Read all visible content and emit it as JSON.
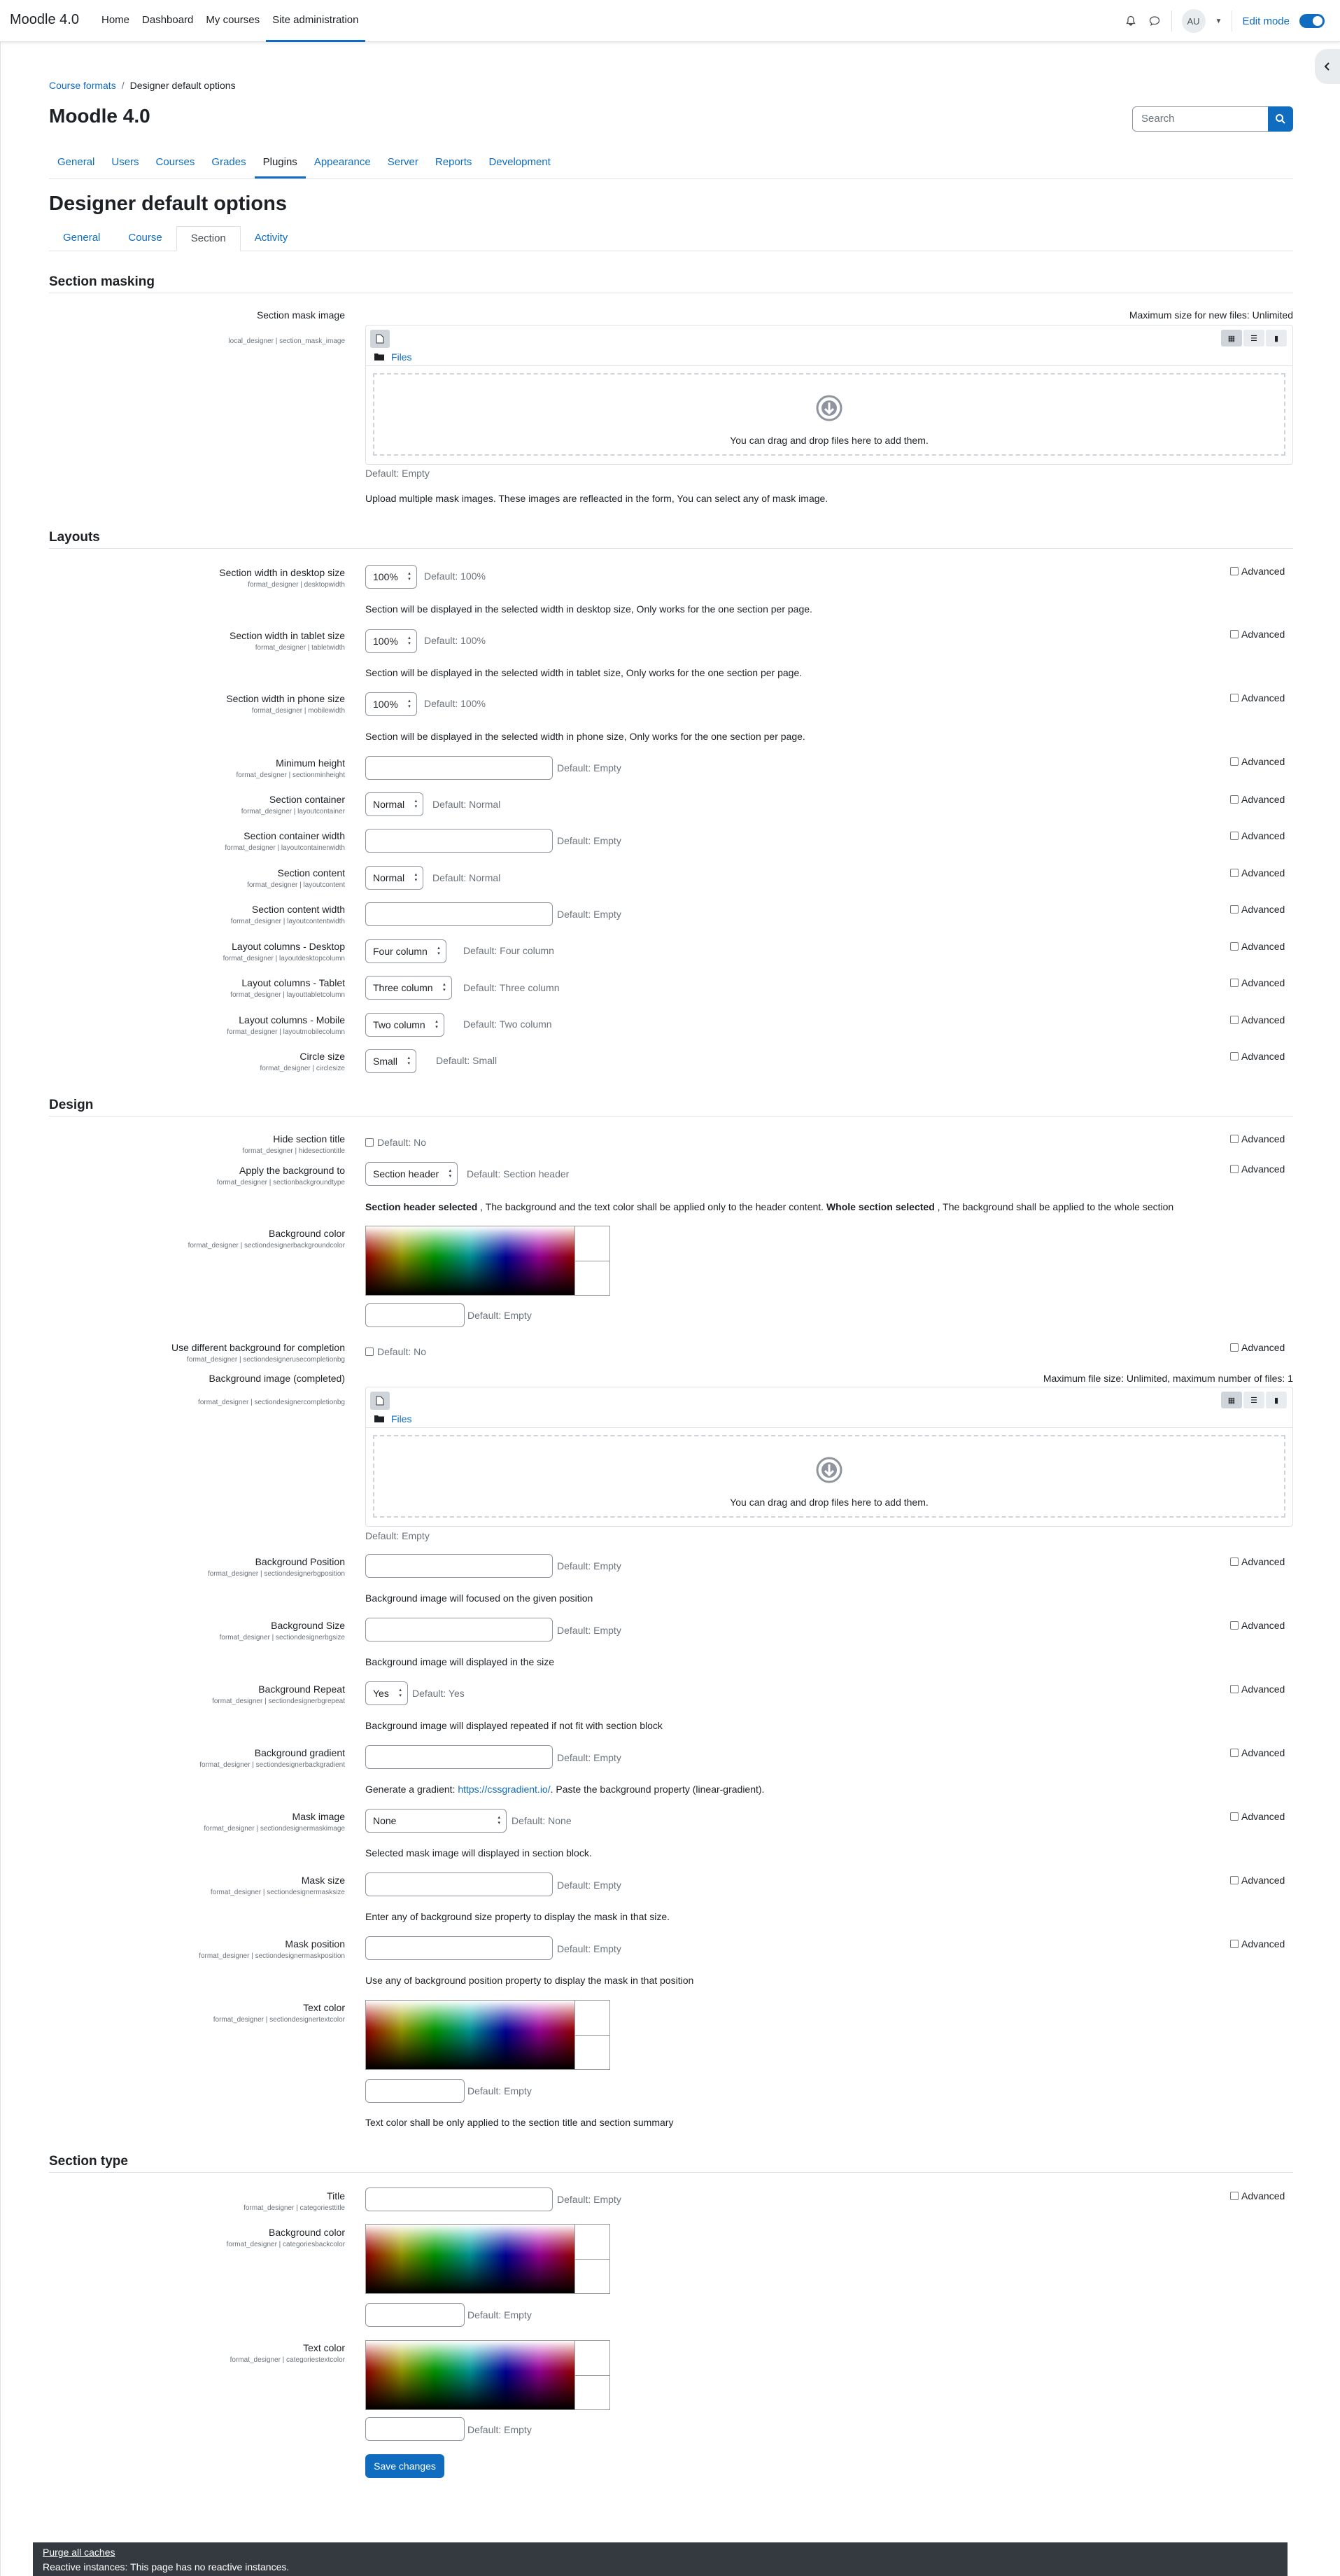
{
  "navbar": {
    "brand": "Moodle 4.0",
    "items": [
      "Home",
      "Dashboard",
      "My courses",
      "Site administration"
    ],
    "avatar_initials": "AU",
    "edit_mode_label": "Edit mode"
  },
  "breadcrumb": [
    "Course formats",
    "Designer default options"
  ],
  "site_title": "Moodle 4.0",
  "search": {
    "placeholder": "Search"
  },
  "admin_tabs": [
    "General",
    "Users",
    "Courses",
    "Grades",
    "Plugins",
    "Appearance",
    "Server",
    "Reports",
    "Development"
  ],
  "page_heading": "Designer default options",
  "sub_tabs": [
    "General",
    "Course",
    "Section",
    "Activity"
  ],
  "common": {
    "advanced": "Advanced",
    "default_empty": "Default: Empty",
    "files_label": "Files",
    "drop_text": "You can drag and drop files here to add them."
  },
  "masking": {
    "heading": "Section masking",
    "label": "Section mask image",
    "sub": "local_designer | section_mask_image",
    "maxsize": "Maximum size for new files: Unlimited",
    "default": "Default: Empty",
    "desc": "Upload multiple mask images. These images are refleacted in the form, You can select any of mask image."
  },
  "layouts": {
    "heading": "Layouts",
    "desktop": {
      "label": "Section width in desktop size",
      "sub": "format_designer | desktopwidth",
      "value": "100%",
      "default": "Default: 100%",
      "desc": "Section will be displayed in the selected width in desktop size, Only works for the one section per page."
    },
    "tablet": {
      "label": "Section width in tablet size",
      "sub": "format_designer | tabletwidth",
      "value": "100%",
      "default": "Default: 100%",
      "desc": "Section will be displayed in the selected width in tablet size, Only works for the one section per page."
    },
    "phone": {
      "label": "Section width in phone size",
      "sub": "format_designer | mobilewidth",
      "value": "100%",
      "default": "Default: 100%",
      "desc": "Section will be displayed in the selected width in phone size, Only works for the one section per page."
    },
    "min_height": {
      "label": "Minimum height",
      "sub": "format_designer | sectionminheight",
      "default": "Default: Empty"
    },
    "container": {
      "label": "Section container",
      "sub": "format_designer | layoutcontainer",
      "value": "Normal",
      "default": "Default: Normal"
    },
    "container_width": {
      "label": "Section container width",
      "sub": "format_designer | layoutcontainerwidth",
      "default": "Default: Empty"
    },
    "content": {
      "label": "Section content",
      "sub": "format_designer | layoutcontent",
      "value": "Normal",
      "default": "Default: Normal"
    },
    "content_width": {
      "label": "Section content width",
      "sub": "format_designer | layoutcontentwidth",
      "default": "Default: Empty"
    },
    "cols_desktop": {
      "label": "Layout columns - Desktop",
      "sub": "format_designer | layoutdesktopcolumn",
      "value": "Four column",
      "default": "Default: Four column"
    },
    "cols_tablet": {
      "label": "Layout columns - Tablet",
      "sub": "format_designer | layouttabletcolumn",
      "value": "Three column",
      "default": "Default: Three column"
    },
    "cols_mobile": {
      "label": "Layout columns - Mobile",
      "sub": "format_designer | layoutmobilecolumn",
      "value": "Two column",
      "default": "Default: Two column"
    },
    "circle": {
      "label": "Circle size",
      "sub": "format_designer | circlesize",
      "value": "Small",
      "default": "Default: Small"
    }
  },
  "design": {
    "heading": "Design",
    "hide_title": {
      "label": "Hide section title",
      "sub": "format_designer | hidesectiontitle",
      "default": "Default: No"
    },
    "apply_bg": {
      "label": "Apply the background to",
      "sub": "format_designer | sectionbackgroundtype",
      "value": "Section header",
      "default": "Default: Section header"
    },
    "apply_desc": {
      "b1": "Section header selected",
      "t1": " , The background and the text color shall be applied only to the header content. ",
      "b2": "Whole section selected",
      "t2": " , The background shall be applied to the whole section"
    },
    "bg_color": {
      "label": "Background color",
      "sub": "format_designer | sectiondesignerbackgroundcolor",
      "default": "Default: Empty"
    },
    "diff_bg": {
      "label": "Use different background for completion",
      "sub": "format_designer | sectiondesignerusecompletionbg",
      "default": "Default: No"
    },
    "bg_image": {
      "label": "Background image (completed)",
      "sub": "format_designer | sectiondesignercompletionbg",
      "maxsize": "Maximum file size: Unlimited, maximum number of files: 1",
      "default": "Default: Empty"
    },
    "bg_position": {
      "label": "Background Position",
      "sub": "format_designer | sectiondesignerbgposition",
      "default": "Default: Empty",
      "desc": "Background image will focused on the given position"
    },
    "bg_size": {
      "label": "Background Size",
      "sub": "format_designer | sectiondesignerbgsize",
      "default": "Default: Empty",
      "desc": "Background image will displayed in the size"
    },
    "bg_repeat": {
      "label": "Background Repeat",
      "sub": "format_designer | sectiondesignerbgrepeat",
      "value": "Yes",
      "default": "Default: Yes",
      "desc": "Background image will displayed repeated if not fit with section block"
    },
    "bg_gradient": {
      "label": "Background gradient",
      "sub": "format_designer | sectiondesignerbackgradient",
      "default": "Default: Empty",
      "desc_pre": "Generate a gradient: ",
      "desc_link": "https://cssgradient.io/",
      "desc_post": ". Paste the background property (linear-gradient)."
    },
    "mask_image": {
      "label": "Mask image",
      "sub": "format_designer | sectiondesignermaskimage",
      "value": "None",
      "default": "Default: None",
      "desc": "Selected mask image will displayed in section block."
    },
    "mask_size": {
      "label": "Mask size",
      "sub": "format_designer | sectiondesignermasksize",
      "default": "Default: Empty",
      "desc": "Enter any of background size property to display the mask in that size."
    },
    "mask_position": {
      "label": "Mask position",
      "sub": "format_designer | sectiondesignermaskposition",
      "default": "Default: Empty",
      "desc": "Use any of background position property to display the mask in that position"
    },
    "text_color": {
      "label": "Text color",
      "sub": "format_designer | sectiondesignertextcolor",
      "default": "Default: Empty",
      "desc": "Text color shall be only applied to the section title and section summary"
    }
  },
  "section_type": {
    "heading": "Section type",
    "title": {
      "label": "Title",
      "sub": "format_designer | categoriesttitle",
      "default": "Default: Empty"
    },
    "bg_color": {
      "label": "Background color",
      "sub": "format_designer | categoriesbackcolor",
      "default": "Default: Empty"
    },
    "text_color": {
      "label": "Text color",
      "sub": "format_designer | categoriestextcolor",
      "default": "Default: Empty"
    }
  },
  "save_button": "Save changes",
  "footer": {
    "purge": "Purge all caches",
    "reactive": "Reactive instances: This page has no reactive instances."
  },
  "colors": {
    "accent": "#0f6cbf",
    "footer_bg": "#343a40"
  }
}
